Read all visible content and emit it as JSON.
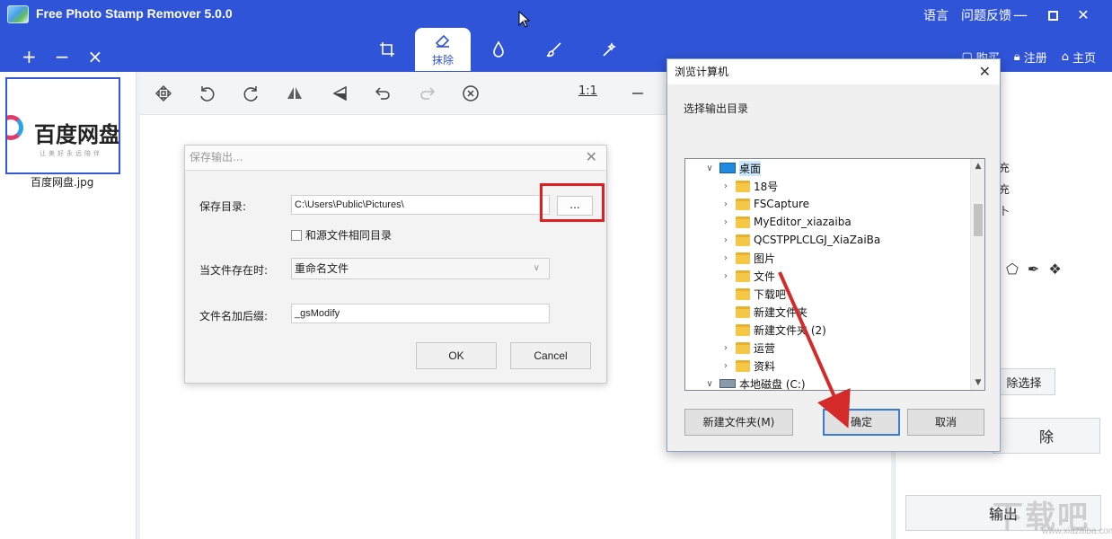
{
  "app": {
    "title": "Free Photo Stamp Remover 5.0.0",
    "top_links": [
      "语言",
      "问题反馈"
    ]
  },
  "toolbar": {
    "left_buttons": [
      "+",
      "−",
      "×"
    ],
    "tabs": [
      {
        "name": "crop",
        "label": ""
      },
      {
        "name": "erase",
        "label": "抹除"
      },
      {
        "name": "drop",
        "label": ""
      },
      {
        "name": "brush",
        "label": ""
      },
      {
        "name": "wand",
        "label": ""
      }
    ],
    "right_items": [
      "购买",
      "注册",
      "主页"
    ]
  },
  "thumbnails": [
    {
      "brand": "百度网盘",
      "slogan": "让美好永远陪伴",
      "filename": "百度网盘.jpg"
    }
  ],
  "canvas_toolbar": {
    "zoom_label": "1:1"
  },
  "right_panel": {
    "partial_texts": [
      "充",
      "充",
      "卜"
    ],
    "buttons": [
      "除选择",
      "除",
      "输出"
    ]
  },
  "save_dialog": {
    "title": "保存输出...",
    "dir_label": "保存目录:",
    "dir_value": "C:\\Users\\Public\\Pictures\\",
    "browse_label": "...",
    "same_dir_label": "和源文件相同目录",
    "exists_label": "当文件存在时:",
    "exists_value": "重命名文件",
    "suffix_label": "文件名加后缀:",
    "suffix_value": "_gsModify",
    "ok_label": "OK",
    "cancel_label": "Cancel"
  },
  "browse_dialog": {
    "title": "浏览计算机",
    "instruction": "选择输出目录",
    "tree": [
      {
        "label": "桌面",
        "level": 0,
        "expander": "expanded",
        "icon": "desktop",
        "selected": true
      },
      {
        "label": "18号",
        "level": 1,
        "expander": "collapsed",
        "icon": "folder"
      },
      {
        "label": "FSCapture",
        "level": 1,
        "expander": "collapsed",
        "icon": "folder"
      },
      {
        "label": "MyEditor_xiazaiba",
        "level": 1,
        "expander": "collapsed",
        "icon": "folder"
      },
      {
        "label": "QCSTPPLCLGJ_XiaZaiBa",
        "level": 1,
        "expander": "collapsed",
        "icon": "folder"
      },
      {
        "label": "图片",
        "level": 1,
        "expander": "collapsed",
        "icon": "folder"
      },
      {
        "label": "文件",
        "level": 1,
        "expander": "collapsed",
        "icon": "folder"
      },
      {
        "label": "下载吧",
        "level": 1,
        "expander": "none",
        "icon": "folder"
      },
      {
        "label": "新建文件夹",
        "level": 1,
        "expander": "none",
        "icon": "folder"
      },
      {
        "label": "新建文件夹 (2)",
        "level": 1,
        "expander": "none",
        "icon": "folder"
      },
      {
        "label": "运营",
        "level": 1,
        "expander": "collapsed",
        "icon": "folder"
      },
      {
        "label": "资料",
        "level": 1,
        "expander": "collapsed",
        "icon": "folder"
      },
      {
        "label": "本地磁盘 (C:)",
        "level": 0,
        "expander": "expanded",
        "icon": "drive"
      }
    ],
    "new_folder_label": "新建文件夹(M)",
    "ok_label": "确定",
    "cancel_label": "取消"
  },
  "watermark": {
    "text": "下载吧",
    "sub": "www.xiazaiba.com"
  },
  "colors": {
    "accent": "#2f54d8",
    "highlight_box": "#e02020",
    "arrow": "#d42a2a"
  }
}
